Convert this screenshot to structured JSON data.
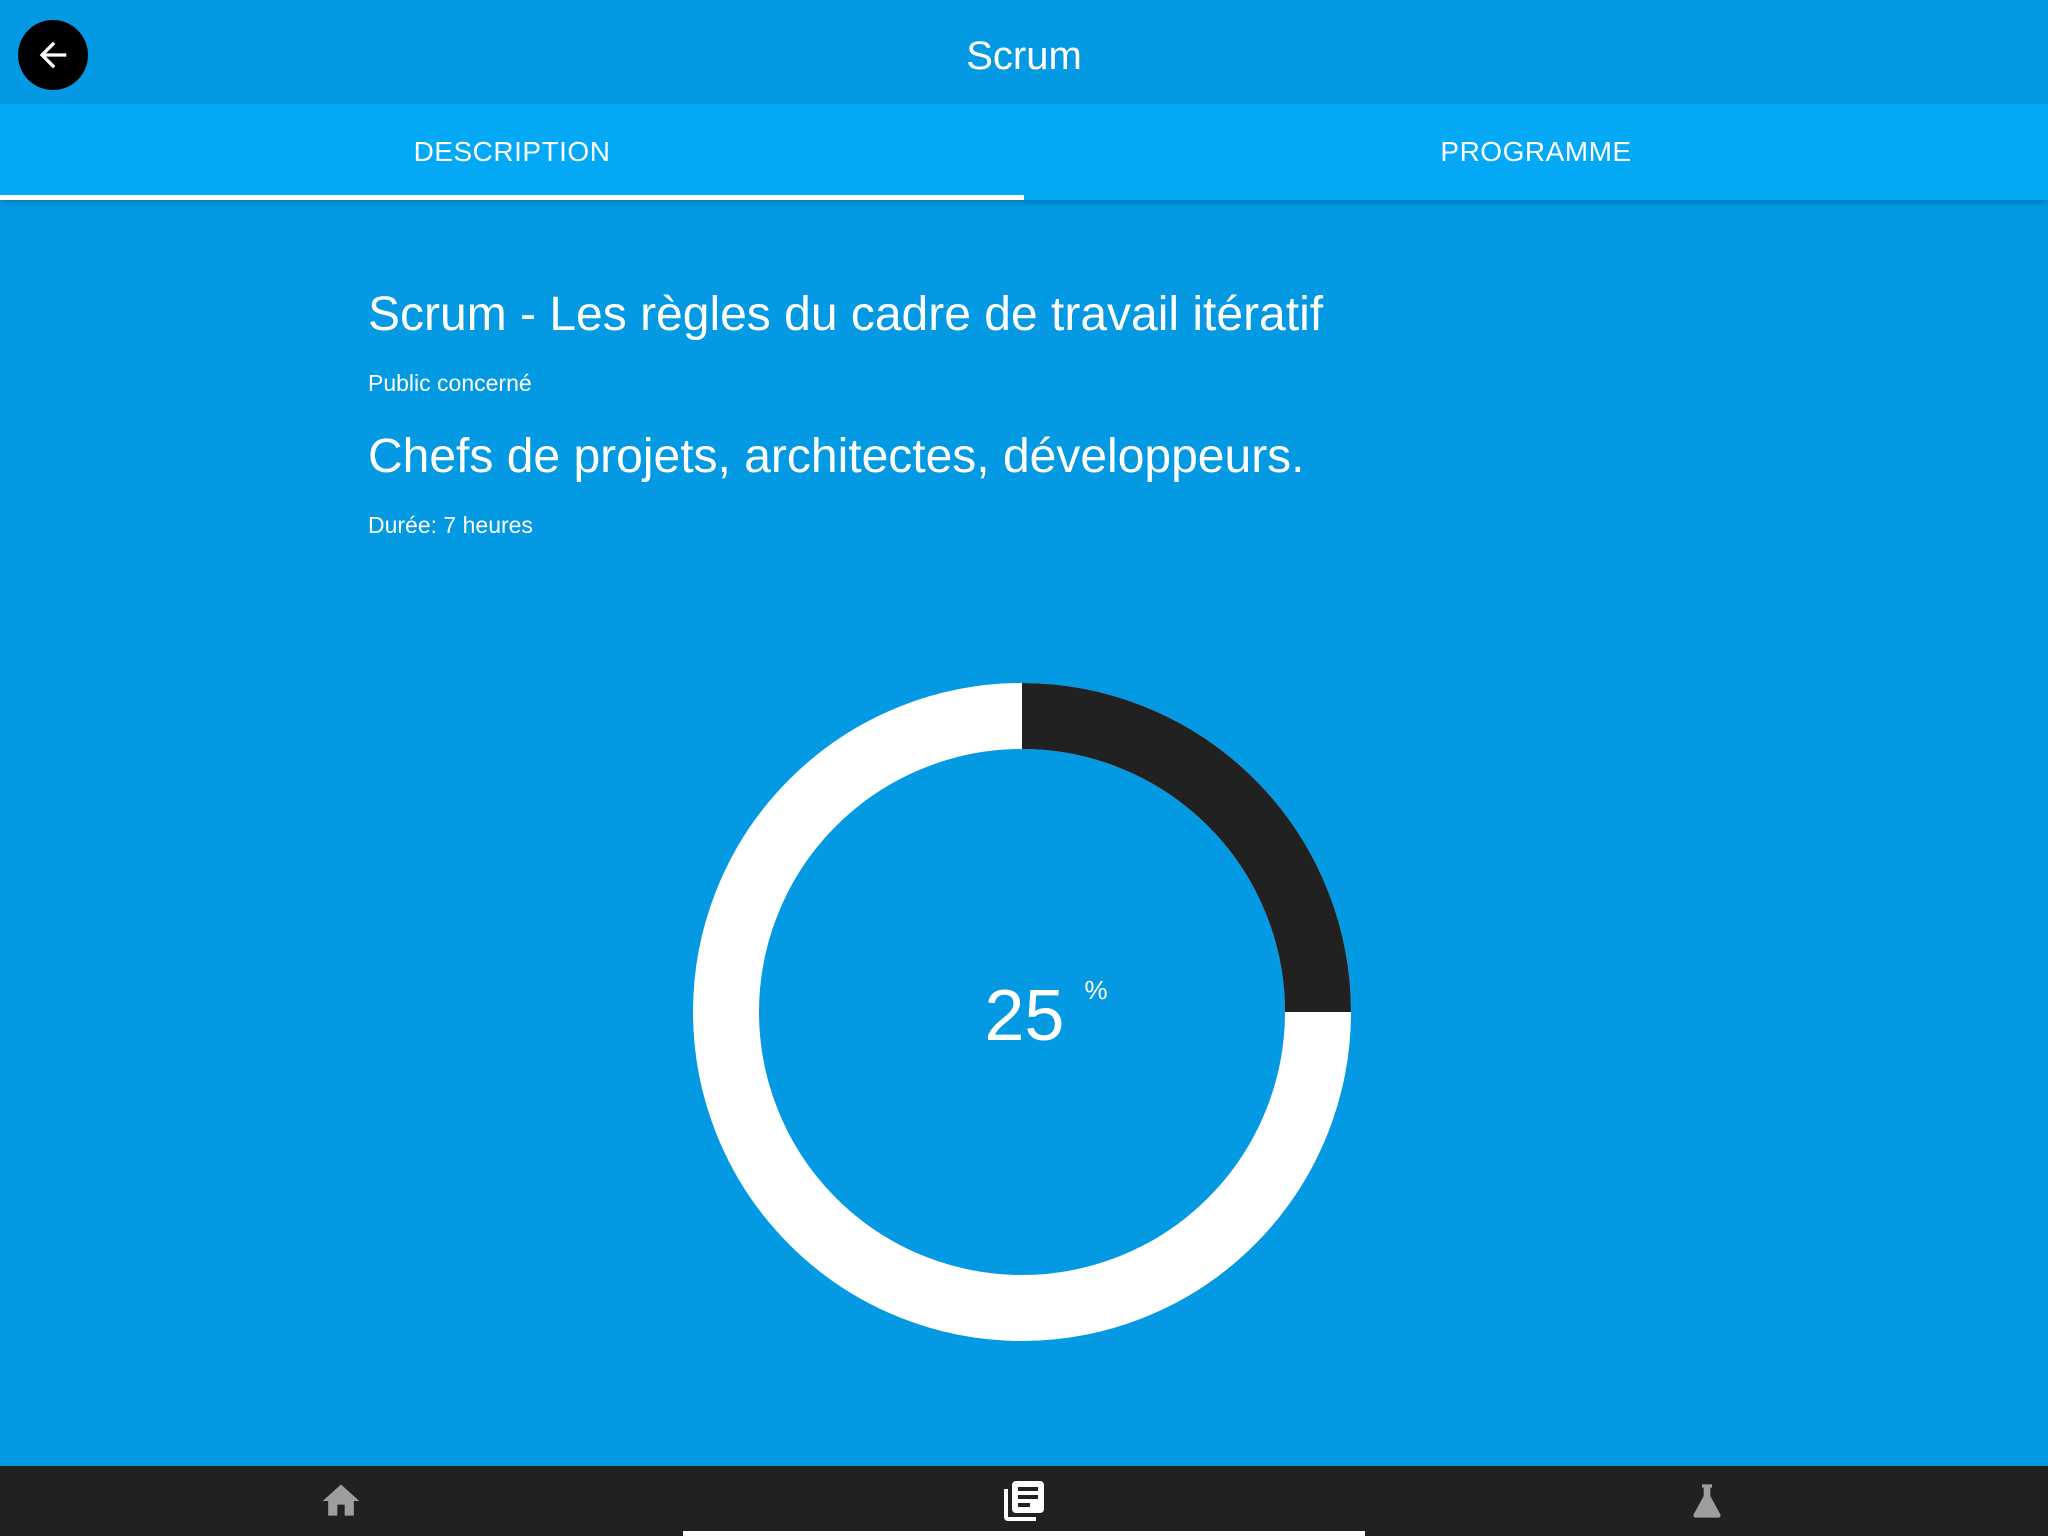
{
  "app_bar": {
    "title": "Scrum",
    "back_icon": "arrow-left-icon"
  },
  "tabs": [
    {
      "label": "DESCRIPTION",
      "selected": true
    },
    {
      "label": "PROGRAMME",
      "selected": false
    }
  ],
  "course": {
    "title": "Scrum - Les règles du cadre de travail itératif",
    "audience_label": "Public concerné",
    "audience": "Chefs de projets, architectes, développeurs.",
    "duration": "Durée: 7 heures"
  },
  "progress": {
    "value": 25,
    "unit": "%",
    "fill_color": "#212121",
    "track_color": "#ffffff"
  },
  "bottom_nav": [
    {
      "icon": "home-icon",
      "selected": false
    },
    {
      "icon": "library-books-icon",
      "selected": true
    },
    {
      "icon": "flask-icon",
      "selected": false
    }
  ],
  "colors": {
    "background": "#0499e3",
    "tab_bar": "#03a9f4",
    "bottom_bar": "#212121"
  }
}
